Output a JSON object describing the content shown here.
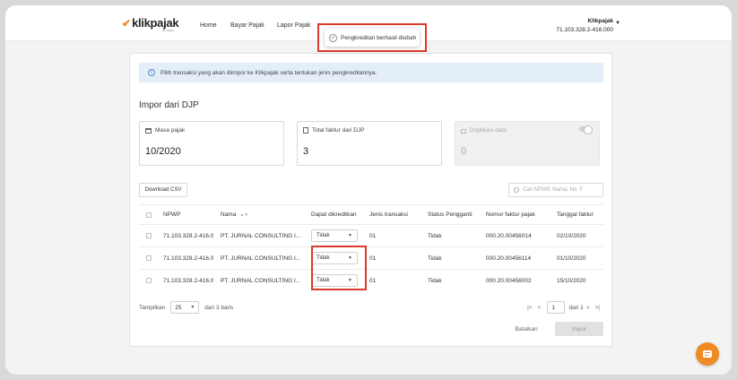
{
  "header": {
    "logo_text": "klikpajak",
    "logo_sub": "by mekari",
    "nav": [
      "Home",
      "Bayar Pajak",
      "Lapor Pajak"
    ],
    "user_name": "Klikpajak",
    "user_npwp": "71.103.328.2-416.000"
  },
  "toast": {
    "message": "Pengkreditan berhasil diubah"
  },
  "info_text": "Pilih transaksi yang akan diimpor ke Klikpajak serta tentukan jenis pengkreditannya.",
  "page_title": "Impor dari DJP",
  "summary": {
    "masa_label": "Masa pajak",
    "masa_value": "10/2020",
    "total_label": "Total faktur dari DJP",
    "total_value": "3",
    "dup_label": "Duplikasi data",
    "dup_value": "0"
  },
  "download_label": "Download CSV",
  "search_placeholder": "Cari NPWP, Nama, No. F",
  "table": {
    "columns": [
      "NPWP",
      "Nama",
      "Dapat dikreditkan",
      "Jenis transaksi",
      "Status Pengganti",
      "Nomor faktur pajak",
      "Tanggal faktur"
    ],
    "rows": [
      {
        "npwp": "71.103.328.2-416.0",
        "nama": "PT. JURNAL CONSULTING I...",
        "kredit": "Tidak",
        "jenis": "01",
        "status": "Tidak",
        "nomor": "000.20.00456014",
        "tanggal": "02/10/2020"
      },
      {
        "npwp": "71.103.328.2-416.0",
        "nama": "PT. JURNAL CONSULTING I...",
        "kredit": "Tidak",
        "jenis": "01",
        "status": "Tidak",
        "nomor": "000.20.00456114",
        "tanggal": "01/10/2020"
      },
      {
        "npwp": "71.103.328.2-416.0",
        "nama": "PT. JURNAL CONSULTING I...",
        "kredit": "Tidak",
        "jenis": "01",
        "status": "Tidak",
        "nomor": "000.20.00456002",
        "tanggal": "15/10/2020"
      }
    ]
  },
  "footer": {
    "show_label": "Tampilkan",
    "page_size": "25",
    "of_rows": "dari 3 baris",
    "page": "1",
    "of_pages": "dari 1"
  },
  "actions": {
    "cancel": "Batalkan",
    "import": "Impor"
  },
  "colors": {
    "accent": "#f08a24",
    "highlight": "#d93a2b",
    "info_bg": "#e4eef8"
  }
}
